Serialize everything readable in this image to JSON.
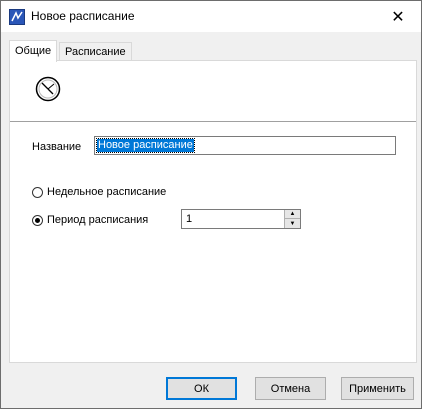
{
  "window": {
    "title": "Новое расписание",
    "icons": {
      "app": "app-icon",
      "close": "close-icon"
    },
    "close_glyph": "✕"
  },
  "tabs": [
    {
      "label": "Общие",
      "active": true
    },
    {
      "label": "Расписание",
      "active": false
    }
  ],
  "general": {
    "icon": "clock-icon",
    "name_label": "Название",
    "name_value": "Новое расписание",
    "schedule_type": {
      "weekly_label": "Недельное расписание",
      "weekly_checked": false,
      "period_label": "Период расписания",
      "period_checked": true,
      "period_value": "1"
    }
  },
  "buttons": {
    "ok": "ОК",
    "cancel": "Отмена",
    "apply": "Применить"
  },
  "colors": {
    "selection": "#0078d7",
    "default_button_border": "#0078d7"
  }
}
